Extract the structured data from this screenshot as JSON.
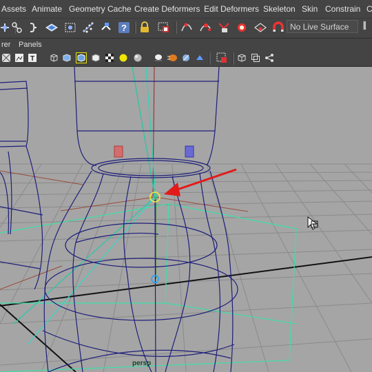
{
  "menubar": {
    "items": [
      "Assets",
      "Animate",
      "Geometry Cache",
      "Create Deformers",
      "Edit Deformers",
      "Skeleton",
      "Skin",
      "Constrain",
      "C"
    ]
  },
  "toolbar": {
    "live_surface": "No Live Surface",
    "icons": [
      "select-tool-icon",
      "lasso-tool-icon",
      "paint-select-icon",
      "move-icon",
      "rotate-icon",
      "scale-icon",
      "universal-manipulator-icon",
      "help-icon",
      "lock-icon",
      "snap-to-grid-icon",
      "snap-to-curve-icon",
      "snap-to-point-icon",
      "snap-to-view-plane-icon",
      "make-live-icon",
      "magnet-icon"
    ]
  },
  "panel_menu": {
    "items": [
      "rer",
      "Panels"
    ]
  },
  "viewport": {
    "camera_label": "persp"
  }
}
